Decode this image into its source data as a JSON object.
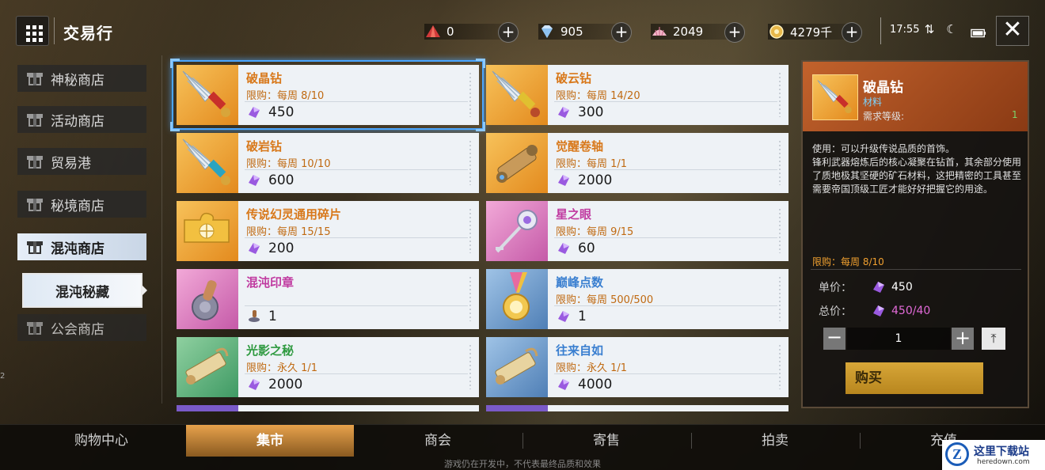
{
  "header": {
    "title": "交易行",
    "currencies": [
      {
        "icon": "red-crystal-icon",
        "value": "0"
      },
      {
        "icon": "diamond-icon",
        "value": "905"
      },
      {
        "icon": "shell-icon",
        "value": "2049"
      },
      {
        "icon": "gold-coin-icon",
        "value": "4279千"
      }
    ],
    "time": "17:55"
  },
  "sidebar": {
    "items": [
      {
        "label": "神秘商店"
      },
      {
        "label": "活动商店"
      },
      {
        "label": "贸易港"
      },
      {
        "label": "秘境商店"
      },
      {
        "label": "混沌商店"
      },
      {
        "label": "公会商店"
      }
    ],
    "active_index": 4,
    "sub_item": "混沌秘藏",
    "edge_number": "2"
  },
  "items": [
    {
      "name": "破晶钻",
      "limit": "限购：每周 8/10",
      "price": "450",
      "rarity": "orange",
      "icon": "drill-red-icon",
      "currency": "purple-crystal-icon"
    },
    {
      "name": "破云钻",
      "limit": "限购：每周 14/20",
      "price": "300",
      "rarity": "orange",
      "icon": "drill-gold-icon",
      "currency": "purple-crystal-icon"
    },
    {
      "name": "破岩钻",
      "limit": "限购：每周 10/10",
      "price": "600",
      "rarity": "orange",
      "icon": "drill-blue-icon",
      "currency": "purple-crystal-icon"
    },
    {
      "name": "觉醒卷轴",
      "limit": "限购：每周 1/1",
      "price": "2000",
      "rarity": "orange",
      "icon": "scroll-case-icon",
      "currency": "purple-crystal-icon"
    },
    {
      "name": "传说幻灵通用碎片",
      "limit": "限购：每周 15/15",
      "price": "200",
      "rarity": "orange",
      "icon": "puzzle-piece-icon",
      "currency": "purple-crystal-icon"
    },
    {
      "name": "星之眼",
      "limit": "限购：每周 9/15",
      "price": "60",
      "rarity": "pink",
      "icon": "star-key-icon",
      "currency": "purple-crystal-icon"
    },
    {
      "name": "混沌印章",
      "limit": "",
      "price": "1",
      "rarity": "pink",
      "icon": "seal-stamp-icon",
      "currency": "stamp-icon"
    },
    {
      "name": "巅峰点数",
      "limit": "限购：每周 500/500",
      "price": "1",
      "rarity": "blue",
      "icon": "medal-icon",
      "currency": "purple-crystal-icon"
    },
    {
      "name": "光影之秘",
      "limit": "限购：永久 1/1",
      "price": "2000",
      "rarity": "green",
      "icon": "scroll-icon",
      "currency": "purple-crystal-icon"
    },
    {
      "name": "往来自如",
      "limit": "限购：永久 1/1",
      "price": "4000",
      "rarity": "blue",
      "icon": "scroll-icon",
      "currency": "purple-crystal-icon"
    }
  ],
  "selected_index": 0,
  "detail": {
    "name": "破晶钻",
    "type": "材料",
    "requirement_label": "需求等级:",
    "requirement_value": "1",
    "description": "使用：可以升级传说品质的首饰。\n锋利武器熔炼后的核心凝聚在钻首，其余部分使用了质地极其坚硬的矿石材料，这把精密的工具甚至需要帝国顶级工匠才能好好把握它的用途。",
    "limit": "限购：每周 8/10",
    "unit_label": "单价：",
    "unit_price": "450",
    "total_label": "总价：",
    "total_price": "450/40",
    "quantity": "1",
    "buy_label": "购买"
  },
  "bottom_tabs": [
    {
      "label": "购物中心"
    },
    {
      "label": "集市"
    },
    {
      "label": "商会"
    },
    {
      "label": "寄售"
    },
    {
      "label": "拍卖"
    },
    {
      "label": "充值"
    }
  ],
  "bottom_active_index": 1,
  "footer_note": "游戏仍在开发中，不代表最终品质和效果",
  "watermark": {
    "title": "这里下载站",
    "subtitle": "heredown.com"
  }
}
